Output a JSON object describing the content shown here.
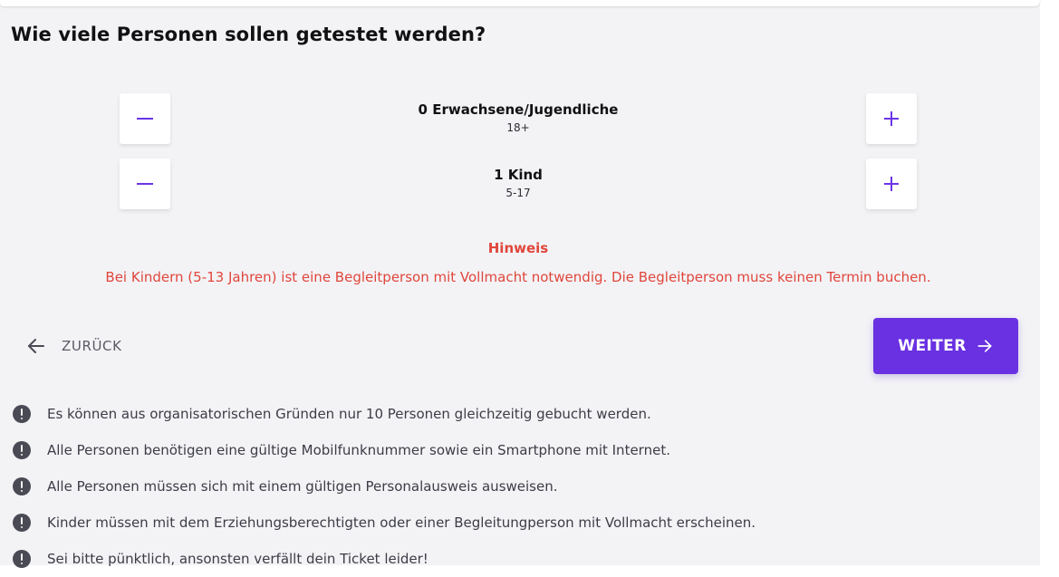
{
  "page": {
    "title": "Wie viele Personen sollen getestet werden?"
  },
  "counters": [
    {
      "label": "0 Erwachsene/Jugendliche",
      "age_range": "18+",
      "count": 0
    },
    {
      "label": "1 Kind",
      "age_range": "5-17",
      "count": 1
    }
  ],
  "notice": {
    "title": "Hinweis",
    "text": "Bei Kindern (5-13 Jahren) ist eine Begleitperson mit Vollmacht notwendig. Die Begleitperson muss keinen Termin buchen."
  },
  "nav": {
    "back_label": "ZURÜCK",
    "next_label": "WEITER"
  },
  "info": [
    "Es können aus organisatorischen Gründen nur 10 Personen gleichzeitig gebucht werden.",
    "Alle Personen benötigen eine gültige Mobilfunknummer sowie ein Smartphone mit Internet.",
    "Alle Personen müssen sich mit einem gültigen Personalausweis ausweisen.",
    "Kinder müssen mit dem Erziehungsberechtigten oder einer Begleitungperson mit Vollmacht erscheinen.",
    "Sei bitte pünktlich, ansonsten verfällt dein Ticket leider!"
  ],
  "icons": {
    "decrement": "minus-icon",
    "increment": "plus-icon",
    "back": "arrow-left-icon",
    "next": "arrow-right-icon",
    "info": "exclamation-circle-icon"
  },
  "colors": {
    "accent": "#6931e2",
    "warning": "#e0463b",
    "background": "#f3f3f6"
  }
}
